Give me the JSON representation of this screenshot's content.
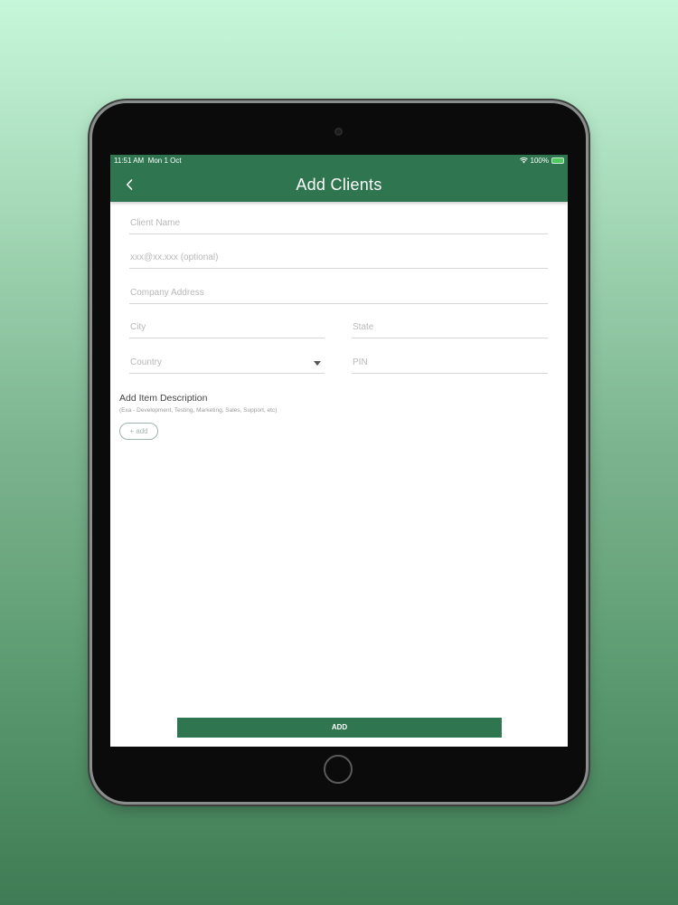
{
  "status_bar": {
    "time": "11:51 AM",
    "date": "Mon 1 Oct",
    "battery": "100%",
    "icons": [
      "wifi-icon",
      "battery-icon"
    ]
  },
  "app_bar": {
    "title": "Add Clients",
    "back_icon": "chevron-left-icon",
    "background_color": "#2e7550"
  },
  "form": {
    "client_name": {
      "placeholder": "Client Name",
      "value": ""
    },
    "email": {
      "placeholder": "xxx@xx.xxx (optional)",
      "value": ""
    },
    "company_address": {
      "placeholder": "Company Address",
      "value": ""
    },
    "city": {
      "placeholder": "City",
      "value": ""
    },
    "state": {
      "placeholder": "State",
      "value": ""
    },
    "country": {
      "placeholder": "Country",
      "value": ""
    },
    "pin": {
      "placeholder": "PIN",
      "value": ""
    }
  },
  "item_description": {
    "title": "Add Item Description",
    "hint": "(Exa - Development, Testing, Marketing, Sales, Support, etc)",
    "add_label": "+ add"
  },
  "submit": {
    "label": "ADD"
  }
}
